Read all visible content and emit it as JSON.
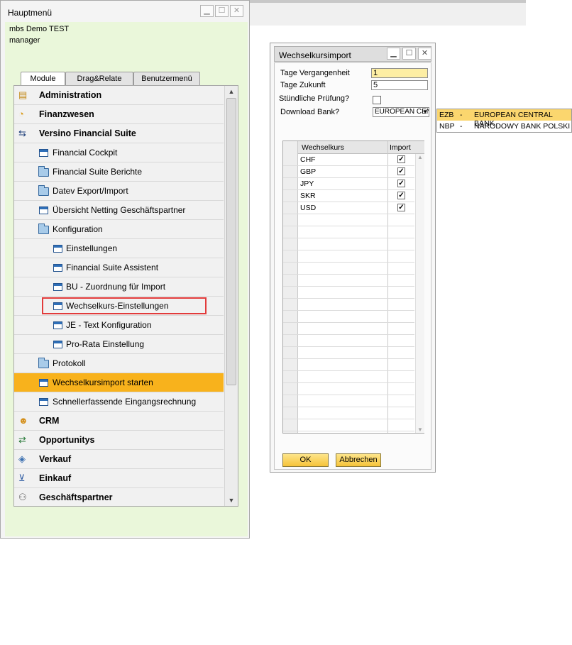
{
  "main_window": {
    "title": "Hauptmenü",
    "company": "mbs Demo TEST",
    "user": "manager",
    "buttons": {
      "minimize": "▁",
      "maximize": "☐",
      "close": "✕"
    },
    "tabs": [
      {
        "label": "Module",
        "active": true
      },
      {
        "label": "Drag&Relate",
        "active": false
      },
      {
        "label": "Benutzermenü",
        "active": false
      }
    ],
    "menu": [
      {
        "label": "Administration",
        "icon": "administration-icon",
        "level": 0,
        "bold": true
      },
      {
        "label": "Finanzwesen",
        "icon": "finance-pie-icon",
        "level": 0,
        "bold": true
      },
      {
        "label": "Versino Financial Suite",
        "icon": "versino-icon",
        "level": 0,
        "bold": true
      },
      {
        "label": "Financial Cockpit",
        "icon": "form-icon",
        "level": 1
      },
      {
        "label": "Financial Suite Berichte",
        "icon": "folder-icon",
        "level": 1
      },
      {
        "label": "Datev Export/Import",
        "icon": "folder-icon",
        "level": 1
      },
      {
        "label": "Übersicht Netting Geschäftspartner",
        "icon": "form-icon",
        "level": 1
      },
      {
        "label": "Konfiguration",
        "icon": "folder-open-icon",
        "level": 1
      },
      {
        "label": "Einstellungen",
        "icon": "form-icon",
        "level": 2
      },
      {
        "label": "Financial Suite Assistent",
        "icon": "form-icon",
        "level": 2
      },
      {
        "label": "BU - Zuordnung für Import",
        "icon": "form-icon",
        "level": 2
      },
      {
        "label": "Wechselkurs-Einstellungen",
        "icon": "form-icon",
        "level": 2,
        "highlighted": true
      },
      {
        "label": "JE - Text Konfiguration",
        "icon": "form-icon",
        "level": 2
      },
      {
        "label": "Pro-Rata Einstellung",
        "icon": "form-icon",
        "level": 2
      },
      {
        "label": "Protokoll",
        "icon": "folder-icon",
        "level": 1
      },
      {
        "label": "Wechselkursimport starten",
        "icon": "form-icon",
        "level": 1,
        "selected": true
      },
      {
        "label": "Schnellerfassende Eingangsrechnung",
        "icon": "form-icon",
        "level": 1
      },
      {
        "label": "CRM",
        "icon": "crm-icon",
        "level": 0,
        "bold": true
      },
      {
        "label": "Opportunitys",
        "icon": "opportunity-icon",
        "level": 0,
        "bold": true
      },
      {
        "label": "Verkauf",
        "icon": "sales-tag-icon",
        "level": 0,
        "bold": true
      },
      {
        "label": "Einkauf",
        "icon": "cart-icon",
        "level": 0,
        "bold": true
      },
      {
        "label": "Geschäftspartner",
        "icon": "partners-icon",
        "level": 0,
        "bold": true
      }
    ]
  },
  "import_window": {
    "title": "Wechselkursimport",
    "fields": {
      "days_past_label": "Tage Vergangenheit",
      "days_past_value": "1",
      "days_future_label": "Tage Zukunft",
      "days_future_value": "5",
      "hourly_check_label": "Stündliche Prüfung?",
      "hourly_check_value": false,
      "bank_label": "Download Bank?",
      "bank_value": "EUROPEAN CENTRAL BANK"
    },
    "grid": {
      "col_rate": "Wechselkurs",
      "col_import": "Import",
      "rows": [
        {
          "currency": "CHF",
          "import": true
        },
        {
          "currency": "GBP",
          "import": true
        },
        {
          "currency": "JPY",
          "import": true
        },
        {
          "currency": "SKR",
          "import": true
        },
        {
          "currency": "USD",
          "import": true
        }
      ]
    },
    "ok_button": "OK",
    "cancel_button": "Abbrechen"
  },
  "bank_dropdown": [
    {
      "code": "EZB",
      "dash": "-",
      "name": "EUROPEAN CENTRAL BANK",
      "highlighted": true
    },
    {
      "code": "NBP",
      "dash": "-",
      "name": "NARODOWY BANK POLSKI",
      "highlighted": false
    }
  ],
  "colors": {
    "menu_background": "#eaf7da",
    "selected_row": "#f8b21c",
    "highlight_border": "#e23b3b",
    "button_yellow": "#f6c33a"
  }
}
